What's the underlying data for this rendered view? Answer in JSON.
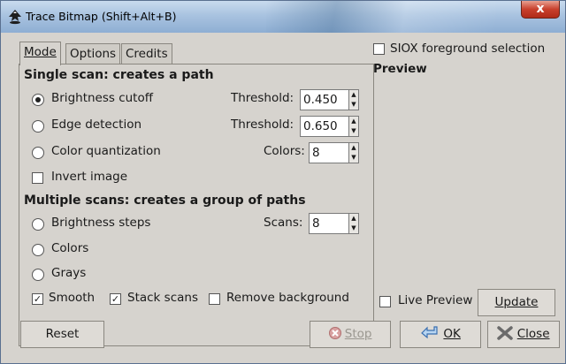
{
  "window": {
    "title": "Trace Bitmap (Shift+Alt+B)",
    "close_label": "x"
  },
  "tabs": [
    {
      "label": "Mode",
      "active": true
    },
    {
      "label": "Options",
      "active": false
    },
    {
      "label": "Credits",
      "active": false
    }
  ],
  "single_scan": {
    "heading": "Single scan: creates a path",
    "brightness_cutoff": {
      "label": "Brightness cutoff",
      "checked": true,
      "param_label": "Threshold:",
      "value": "0.450"
    },
    "edge_detection": {
      "label": "Edge detection",
      "checked": false,
      "param_label": "Threshold:",
      "value": "0.650"
    },
    "color_quantization": {
      "label": "Color quantization",
      "checked": false,
      "param_label": "Colors:",
      "value": "8"
    },
    "invert_image": {
      "label": "Invert image",
      "checked": false
    }
  },
  "multiple_scans": {
    "heading": "Multiple scans: creates a group of paths",
    "brightness_steps": {
      "label": "Brightness steps",
      "checked": false,
      "param_label": "Scans:",
      "value": "8"
    },
    "colors": {
      "label": "Colors",
      "checked": false
    },
    "grays": {
      "label": "Grays",
      "checked": false
    },
    "smooth": {
      "label": "Smooth",
      "checked": true
    },
    "stack_scans": {
      "label": "Stack scans",
      "checked": true
    },
    "remove_background": {
      "label": "Remove background",
      "checked": false
    }
  },
  "siox": {
    "label": "SIOX foreground selection",
    "checked": false
  },
  "preview": {
    "heading": "Preview",
    "live_preview": {
      "label": "Live Preview",
      "checked": false
    },
    "update_label": "Update"
  },
  "buttons": {
    "reset": "Reset",
    "stop": "Stop",
    "ok": "OK",
    "close": "Close"
  }
}
